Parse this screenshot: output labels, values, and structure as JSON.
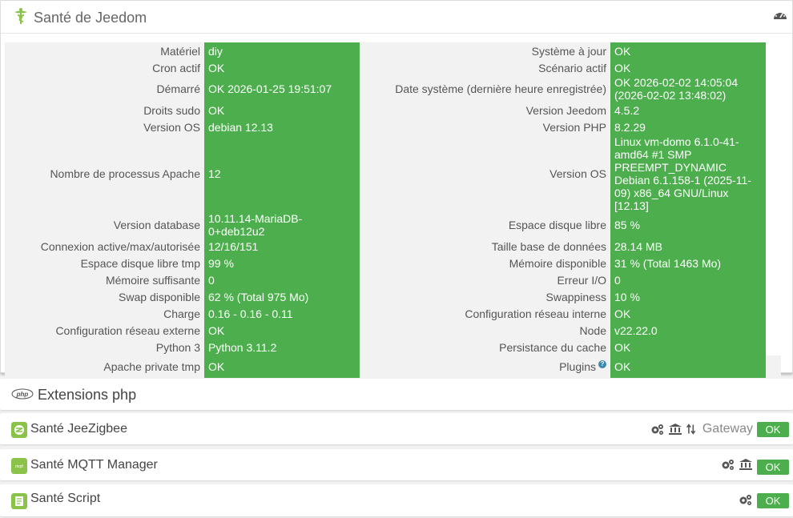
{
  "main": {
    "title": "Santé de Jeedom",
    "rows": [
      {
        "l1": "Matériel",
        "v1": "diy",
        "l2": "Système à jour",
        "v2": "OK",
        "cls": ""
      },
      {
        "l1": "Cron actif",
        "v1": "OK",
        "l2": "Scénario actif",
        "v2": "OK",
        "cls": ""
      },
      {
        "l1": "Démarré",
        "v1": "OK 2026-01-25 19:51:07",
        "l2": "Date système (dernière heure enregistrée)",
        "v2": "OK 2026-02-02 14:05:04\n(2026-02-02 13:48:02)",
        "cls": "row-mid"
      },
      {
        "l1": "Droits sudo",
        "v1": "OK",
        "l2": "Version Jeedom",
        "v2": "4.5.2",
        "cls": ""
      },
      {
        "l1": "Version OS",
        "v1": "debian 12.13",
        "l2": "Version PHP",
        "v2": "8.2.29",
        "cls": ""
      },
      {
        "l1": "Nombre de processus Apache",
        "v1": "12",
        "l2": "Version OS",
        "v2": "Linux vm-domo 6.1.0-41-amd64 #1 SMP PREEMPT_DYNAMIC Debian 6.1.158-1 (2025-11-09) x86_64 GNU/Linux [12.13]",
        "cls": "row-tall"
      },
      {
        "l1": "Version database",
        "v1": "10.11.14-MariaDB-0+deb12u2",
        "l2": "Espace disque libre",
        "v2": "85 %",
        "cls": "row-db"
      },
      {
        "l1": "Connexion active/max/autorisée",
        "v1": "12/16/151",
        "l2": "Taille base de données",
        "v2": "28.14 MB",
        "cls": ""
      },
      {
        "l1": "Espace disque libre tmp",
        "v1": "99 %",
        "l2": "Mémoire disponible",
        "v2": "31 % (Total 1463 Mo)",
        "cls": ""
      },
      {
        "l1": "Mémoire suffisante",
        "v1": "0",
        "l2": "Erreur I/O",
        "v2": "0",
        "cls": ""
      },
      {
        "l1": "Swap disponible",
        "v1": "62 % (Total 975 Mo)",
        "l2": "Swappiness",
        "v2": "10 %",
        "cls": ""
      },
      {
        "l1": "Charge",
        "v1": "0.16 - 0.16 - 0.11",
        "l2": "Configuration réseau interne",
        "v2": "OK",
        "cls": ""
      },
      {
        "l1": "Configuration réseau externe",
        "v1": "OK",
        "l2": "Node",
        "v2": "v22.22.0",
        "cls": ""
      },
      {
        "l1": "Python 3",
        "v1": "Python 3.11.2",
        "l2": "Persistance du cache",
        "v2": "OK",
        "cls": ""
      },
      {
        "l1": "Apache private tmp",
        "v1": "OK",
        "l2": "Plugins",
        "v2": "OK",
        "cls": "row-plugins",
        "help": "?"
      }
    ]
  },
  "extensions": {
    "title": "Extensions php",
    "icon": "php-icon",
    "icon_text": "php"
  },
  "plugins": [
    {
      "title": "Santé JeeZigbee",
      "icon": "jeezigbee-icon",
      "tools": [
        "cogs-icon",
        "bank-icon",
        "sort-icon"
      ],
      "gateway_label": "Gateway",
      "status": "OK"
    },
    {
      "title": "Santé MQTT Manager",
      "icon": "mqtt-icon",
      "tools": [
        "cogs-icon",
        "bank-icon"
      ],
      "status": "OK"
    },
    {
      "title": "Santé Script",
      "icon": "script-icon",
      "tools": [
        "cogs-icon"
      ],
      "status": "OK"
    }
  ],
  "colors": {
    "ok": "#4cae4c",
    "label_bg": "#f2f2f2",
    "accent": "#8bc34a"
  }
}
